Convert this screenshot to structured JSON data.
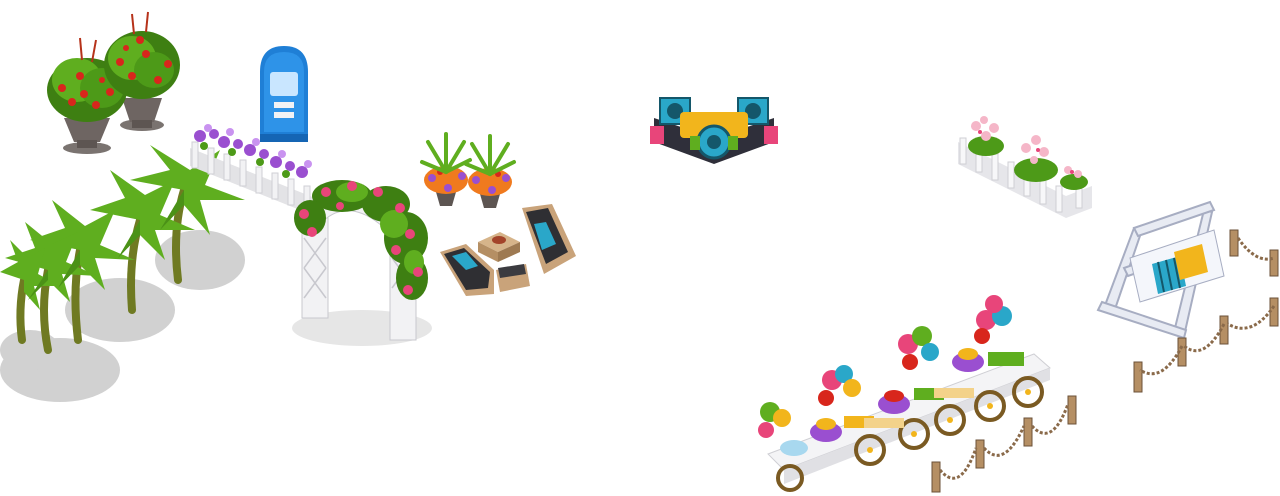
{
  "scene": {
    "background": "#ffffff",
    "items": [
      {
        "id": "potted-red-flowers",
        "icon": "red-berry-urn-planter-icon",
        "count": 2
      },
      {
        "id": "blue-vending-machine",
        "icon": "blue-kiosk-icon"
      },
      {
        "id": "palm-trees",
        "icon": "palm-tree-icon",
        "count": 5
      },
      {
        "id": "white-picket-fence-with-purple-flowers",
        "icon": "flower-fence-icon"
      },
      {
        "id": "rose-arch",
        "icon": "rose-arch-trellis-icon"
      },
      {
        "id": "potted-ferns",
        "icon": "fern-planter-icon",
        "count": 2
      },
      {
        "id": "patio-loungers",
        "icon": "lounge-chair-icon",
        "count": 2
      },
      {
        "id": "side-table",
        "icon": "side-table-icon"
      },
      {
        "id": "dj-booth",
        "icon": "dj-speaker-booth-icon"
      },
      {
        "id": "pink-flower-fence",
        "icon": "pink-flower-fence-icon"
      },
      {
        "id": "garden-swing",
        "icon": "porch-swing-icon"
      },
      {
        "id": "rope-chain-fence",
        "icon": "chain-post-fence-icon"
      },
      {
        "id": "party-buffet-cart",
        "icon": "buffet-cart-with-balloons-icon"
      }
    ],
    "colors": {
      "leaf": "#5fae1f",
      "leaf_dark": "#3e7f12",
      "red_flower": "#d8261c",
      "purple_flower": "#9a4fd0",
      "pink_flower": "#e8457a",
      "white_wood": "#f2f2f4",
      "kiosk_blue": "#1f7fd6",
      "cushion_teal": "#2aa7c9",
      "cushion_yellow": "#f2b51c",
      "wood_brown": "#8a6a4a",
      "shadow": "#c9c9c9"
    }
  }
}
